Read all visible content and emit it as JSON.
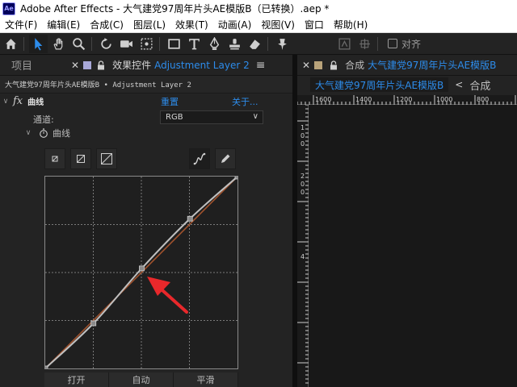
{
  "window": {
    "title": "Adobe After Effects - 大气建党97周年片头AE模版B（已转换）.aep *",
    "app_icon": "Ae"
  },
  "menu": [
    "文件(F)",
    "编辑(E)",
    "合成(C)",
    "图层(L)",
    "效果(T)",
    "动画(A)",
    "视图(V)",
    "窗口",
    "帮助(H)"
  ],
  "toolbar": {
    "tools": [
      "home-icon",
      "selection-icon",
      "hand-icon",
      "zoom-icon",
      "rotate-icon",
      "camera-icon",
      "pan-behind-icon",
      "rectangle-icon",
      "type-icon",
      "pen-icon",
      "stamp-icon",
      "eraser-icon",
      "puppet-icon"
    ],
    "snap_label": "对齐"
  },
  "effects_panel": {
    "tab_project": "项目",
    "tab_effects": "效果控件",
    "tab_layer": "Adjustment Layer 2",
    "comp_path": "大气建党97周年片头AE模版B • Adjustment Layer 2",
    "effect_name": "曲线",
    "reset_link": "重置",
    "about_link": "关于...",
    "channel_label": "通道:",
    "channel_value": "RGB",
    "curves_label": "曲线",
    "buttons": [
      "打开",
      "自动",
      "平滑"
    ]
  },
  "curve": {
    "line_color": "#c0c0c0",
    "reference_color": "#a0522d",
    "points": [
      [
        0,
        0
      ],
      [
        64,
        60
      ],
      [
        128,
        133
      ],
      [
        192,
        199
      ],
      [
        255,
        255
      ]
    ]
  },
  "comp_panel": {
    "tab_label": "合成",
    "comp_name": "大气建党97周年片头AE模版B",
    "subtab_active": "大气建党97周年片头AE模版B",
    "subtab_next": "合成",
    "ruler_top": [
      "1600",
      "1400",
      "1200",
      "1000",
      "800"
    ],
    "ruler_left": [
      "1",
      "0",
      "0",
      "2",
      "0",
      "0",
      "4"
    ]
  },
  "colors": {
    "accent": "#2d8ceb",
    "annotation": "#e8282b"
  }
}
